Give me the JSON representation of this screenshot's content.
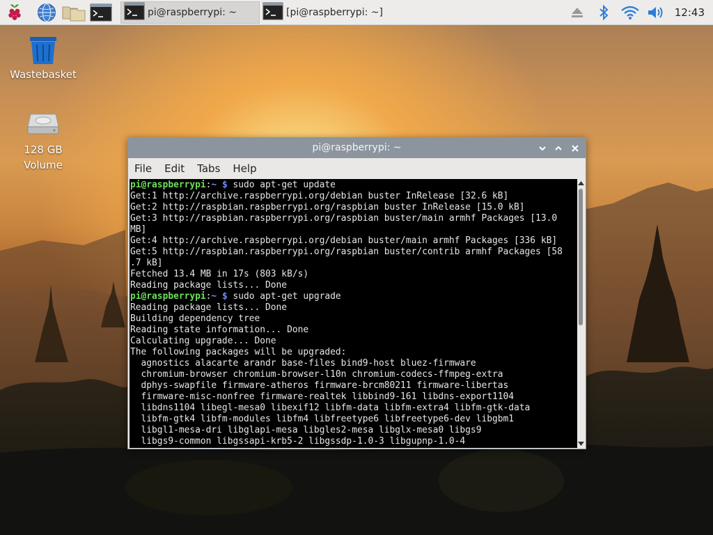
{
  "panel": {
    "launchers": [
      {
        "name": "raspberry-menu-icon"
      },
      {
        "name": "web-browser-icon"
      },
      {
        "name": "file-manager-icon"
      },
      {
        "name": "terminal-icon"
      }
    ],
    "tasks": [
      {
        "label": "pi@raspberrypi: ~",
        "active": true
      },
      {
        "label": "[pi@raspberrypi: ~]",
        "active": false
      }
    ],
    "tray": [
      "eject-icon",
      "bluetooth-icon",
      "wifi-icon",
      "volume-icon"
    ],
    "clock": "12:43"
  },
  "desktop": {
    "icons": [
      {
        "label": "Wastebasket",
        "icon": "trash-icon"
      },
      {
        "label_line1": "128 GB",
        "label_line2": "Volume",
        "icon": "drive-icon"
      }
    ]
  },
  "window": {
    "title": "pi@raspberrypi: ~",
    "controls": [
      "minimize",
      "maximize",
      "close"
    ],
    "menu": [
      "File",
      "Edit",
      "Tabs",
      "Help"
    ]
  },
  "terminal": {
    "prompt_user": "pi@raspberrypi",
    "prompt_sep": ":",
    "prompt_path": "~",
    "prompt_symbol": "$",
    "lines": [
      {
        "type": "cmd",
        "text": " sudo apt-get update"
      },
      {
        "type": "out",
        "text": "Get:1 http://archive.raspberrypi.org/debian buster InRelease [32.6 kB]"
      },
      {
        "type": "out",
        "text": "Get:2 http://raspbian.raspberrypi.org/raspbian buster InRelease [15.0 kB]"
      },
      {
        "type": "out",
        "text": "Get:3 http://raspbian.raspberrypi.org/raspbian buster/main armhf Packages [13.0"
      },
      {
        "type": "out",
        "text": "MB]"
      },
      {
        "type": "out",
        "text": "Get:4 http://archive.raspberrypi.org/debian buster/main armhf Packages [336 kB]"
      },
      {
        "type": "out",
        "text": "Get:5 http://raspbian.raspberrypi.org/raspbian buster/contrib armhf Packages [58"
      },
      {
        "type": "out",
        "text": ".7 kB]"
      },
      {
        "type": "out",
        "text": "Fetched 13.4 MB in 17s (803 kB/s)"
      },
      {
        "type": "out",
        "text": "Reading package lists... Done"
      },
      {
        "type": "cmd",
        "text": " sudo apt-get upgrade"
      },
      {
        "type": "out",
        "text": "Reading package lists... Done"
      },
      {
        "type": "out",
        "text": "Building dependency tree"
      },
      {
        "type": "out",
        "text": "Reading state information... Done"
      },
      {
        "type": "out",
        "text": "Calculating upgrade... Done"
      },
      {
        "type": "out",
        "text": "The following packages will be upgraded:"
      },
      {
        "type": "out",
        "text": "  agnostics alacarte arandr base-files bind9-host bluez-firmware"
      },
      {
        "type": "out",
        "text": "  chromium-browser chromium-browser-l10n chromium-codecs-ffmpeg-extra"
      },
      {
        "type": "out",
        "text": "  dphys-swapfile firmware-atheros firmware-brcm80211 firmware-libertas"
      },
      {
        "type": "out",
        "text": "  firmware-misc-nonfree firmware-realtek libbind9-161 libdns-export1104"
      },
      {
        "type": "out",
        "text": "  libdns1104 libegl-mesa0 libexif12 libfm-data libfm-extra4 libfm-gtk-data"
      },
      {
        "type": "out",
        "text": "  libfm-gtk4 libfm-modules libfm4 libfreetype6 libfreetype6-dev libgbm1"
      },
      {
        "type": "out",
        "text": "  libgl1-mesa-dri libglapi-mesa libgles2-mesa libglx-mesa0 libgs9"
      },
      {
        "type": "out",
        "text": "  libgs9-common libgssapi-krb5-2 libgssdp-1.0-3 libgupnp-1.0-4"
      }
    ]
  }
}
